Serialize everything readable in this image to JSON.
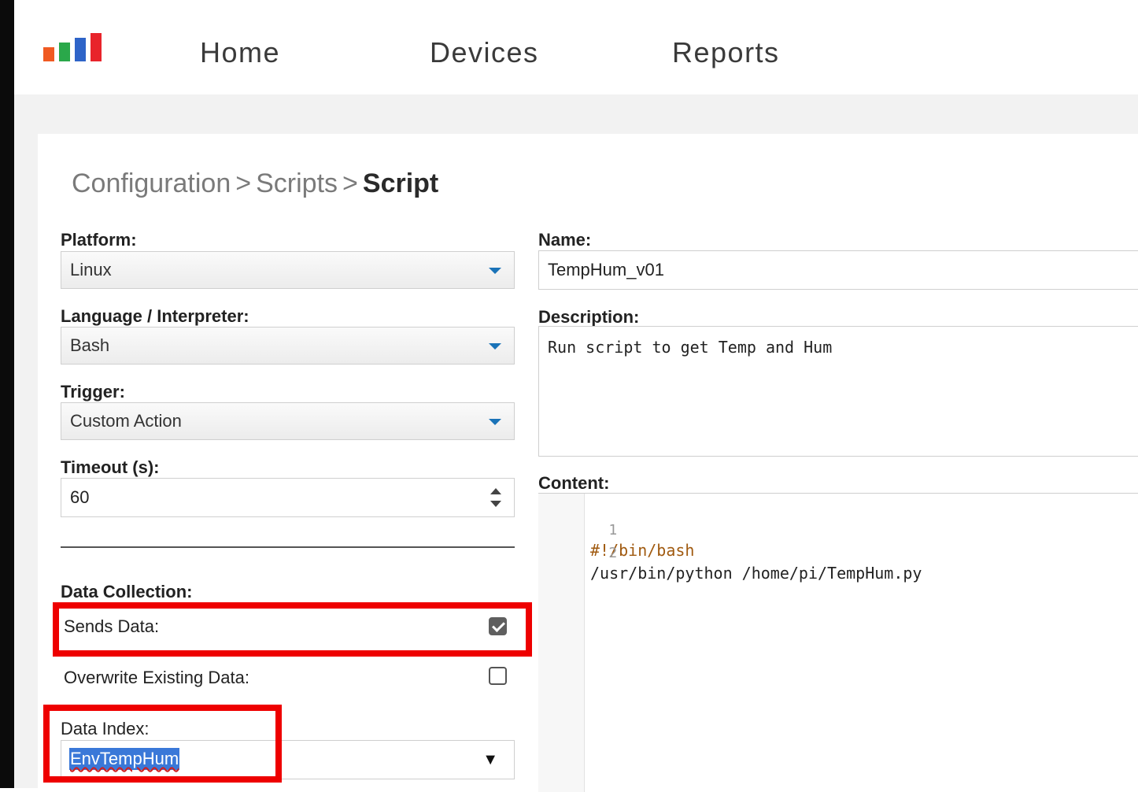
{
  "nav": {
    "logo_colors": [
      "#f05a22",
      "#2aa84a",
      "#2e64c8",
      "#e8242b"
    ],
    "links": [
      "Home",
      "Devices",
      "Reports"
    ]
  },
  "breadcrumb": {
    "items": [
      "Configuration",
      "Scripts"
    ],
    "separator": ">",
    "current": "Script"
  },
  "form": {
    "platform": {
      "label": "Platform:",
      "value": "Linux"
    },
    "language": {
      "label": "Language / Interpreter:",
      "value": "Bash"
    },
    "trigger": {
      "label": "Trigger:",
      "value": "Custom Action"
    },
    "timeout": {
      "label": "Timeout (s):",
      "value": "60"
    },
    "data_collection": {
      "label": "Data Collection:",
      "sends_data": {
        "label": "Sends Data:",
        "checked": true
      },
      "overwrite": {
        "label": "Overwrite Existing Data:",
        "checked": false
      },
      "data_index": {
        "label": "Data Index:",
        "value": "EnvTempHum",
        "arrow": "▼"
      }
    },
    "name": {
      "label": "Name:",
      "value": "TempHum_v01"
    },
    "description": {
      "label": "Description:",
      "value": "Run script to get Temp and Hum"
    },
    "content": {
      "label": "Content:",
      "lines": [
        {
          "number": "1",
          "text": "#!/bin/bash"
        },
        {
          "number": "2",
          "text": "/usr/bin/python /home/pi/TempHum.py"
        }
      ]
    }
  },
  "colors": {
    "highlight": "#ee0000",
    "caret": "#1a73b8",
    "selection": "#3a78d8"
  }
}
